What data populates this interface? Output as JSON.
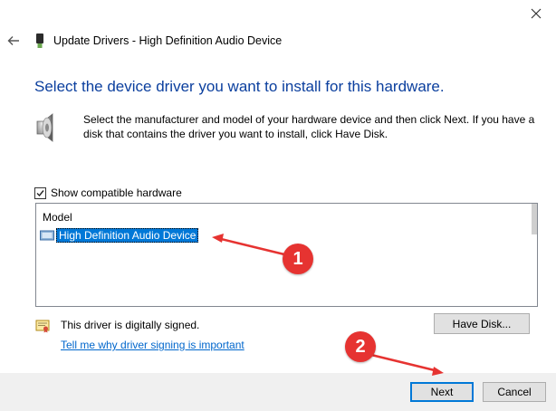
{
  "window": {
    "title": "Update Drivers - High Definition Audio Device"
  },
  "page": {
    "heading": "Select the device driver you want to install for this hardware.",
    "description": "Select the manufacturer and model of your hardware device and then click Next. If you have a disk that contains the driver you want to install, click Have Disk."
  },
  "compatible": {
    "label": "Show compatible hardware",
    "checked": true
  },
  "model_list": {
    "column_header": "Model",
    "items": [
      {
        "label": "High Definition Audio Device",
        "selected": true
      }
    ]
  },
  "signing": {
    "status_text": "This driver is digitally signed.",
    "link_text": "Tell me why driver signing is important"
  },
  "buttons": {
    "have_disk": "Have Disk...",
    "next": "Next",
    "cancel": "Cancel"
  },
  "annotations": {
    "marker1": "1",
    "marker2": "2",
    "color": "#e63331"
  },
  "colors": {
    "heading": "#0b3f9e",
    "selection": "#0078d7",
    "link": "#0066cc",
    "footer": "#f0f0f0"
  },
  "icons": {
    "close": "close-icon",
    "back": "back-arrow-icon",
    "title": "usb-device-icon",
    "speaker": "speaker-icon",
    "row": "audio-device-icon",
    "signed": "certificate-icon"
  }
}
